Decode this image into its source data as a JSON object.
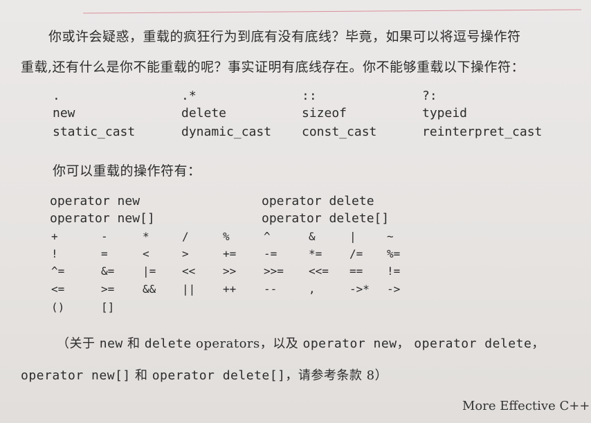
{
  "intro": {
    "line1": "你或许会疑惑，重载的疯狂行为到底有没有底线？毕竟，如果可以将逗号操作符",
    "line2": "重载,还有什么是你不能重载的呢？事实证明有底线存在。你不能够重载以下操作符："
  },
  "not_overloadable": [
    [
      ".",
      ".*",
      "::",
      "?:"
    ],
    [
      "new",
      "delete",
      "sizeof",
      "typeid"
    ],
    [
      "static_cast",
      "dynamic_cast",
      "const_cast",
      "reinterpret_cast"
    ]
  ],
  "overloadable_heading": "你可以重载的操作符有：",
  "overloadable_named": [
    [
      "operator new",
      "operator delete"
    ],
    [
      "operator new[]",
      "operator delete[]"
    ]
  ],
  "overloadable_symbols": [
    [
      "+",
      "-",
      "*",
      "/",
      "%",
      "^",
      "&",
      "|",
      "~"
    ],
    [
      "!",
      "=",
      "<",
      ">",
      "+=",
      "-=",
      "*=",
      "/=",
      "%="
    ],
    [
      "^=",
      "&=",
      "|=",
      "<<",
      ">>",
      ">>=",
      "<<=",
      "==",
      "!="
    ],
    [
      "<=",
      ">=",
      "&&",
      "||",
      "++",
      "--",
      ",",
      "->*",
      "->"
    ],
    [
      "()",
      "[]"
    ]
  ],
  "note": {
    "p1": "（关于",
    "c1": "new",
    "p2": "和",
    "c2": "delete",
    "p3": "operators，以及",
    "c3": "operator new",
    "p4": "，",
    "c4": "operator delete",
    "p5": "，",
    "c5": "operator new[]",
    "p6": "和",
    "c6": "operator delete[]",
    "p7": "，请参考条款 8）"
  },
  "footer": "More Effective C++"
}
